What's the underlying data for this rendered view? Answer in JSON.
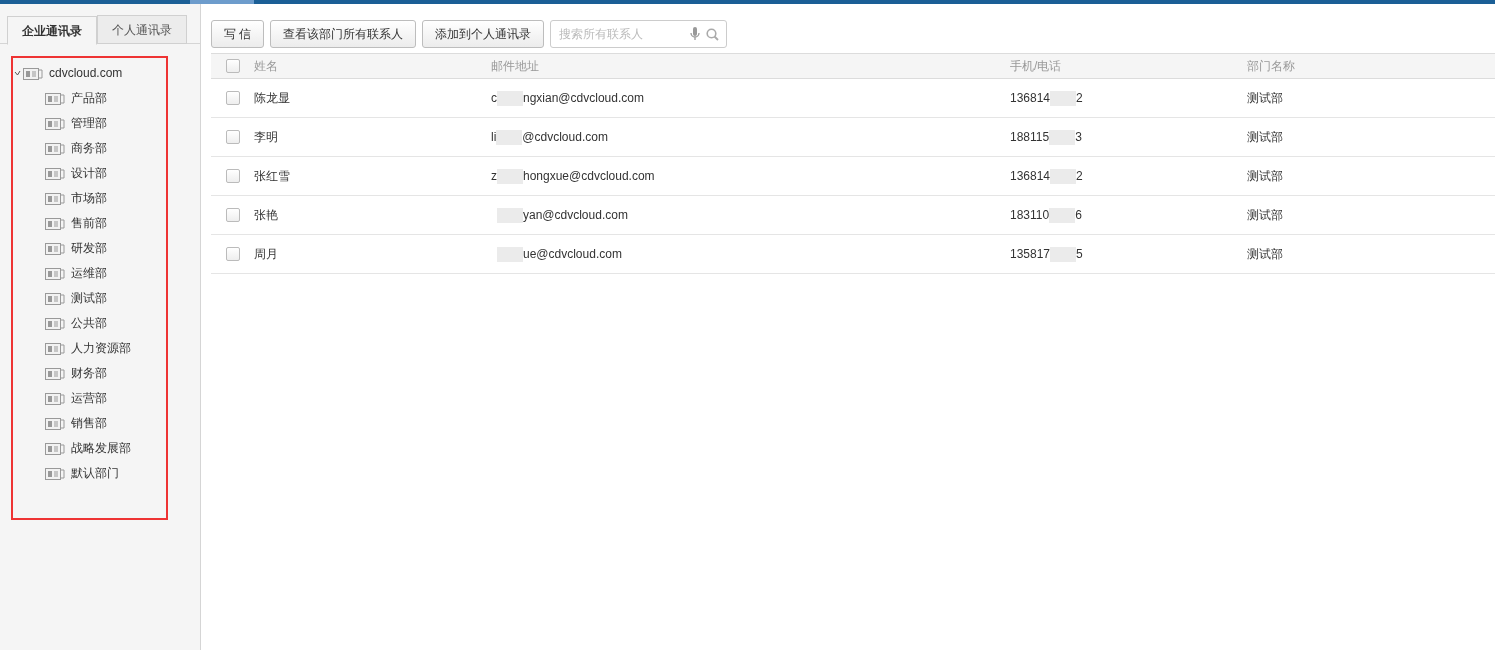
{
  "sidebar": {
    "tabs": [
      {
        "label": "企业通讯录",
        "selected": true
      },
      {
        "label": "个人通讯录",
        "selected": false
      }
    ],
    "tree": [
      {
        "label": "cdvcloud.com",
        "expanded": true,
        "children": [
          {
            "label": "产品部"
          },
          {
            "label": "管理部"
          },
          {
            "label": "商务部"
          },
          {
            "label": "设计部"
          },
          {
            "label": "市场部"
          },
          {
            "label": "售前部"
          },
          {
            "label": "研发部"
          },
          {
            "label": "运维部"
          },
          {
            "label": "测试部"
          },
          {
            "label": "公共部"
          },
          {
            "label": "人力资源部"
          },
          {
            "label": "财务部"
          },
          {
            "label": "运营部"
          },
          {
            "label": "销售部"
          },
          {
            "label": "战略发展部"
          },
          {
            "label": "默认部门"
          }
        ]
      }
    ]
  },
  "toolbar": {
    "buttons": [
      "写 信",
      "查看该部门所有联系人",
      "添加到个人通讯录"
    ],
    "search": {
      "placeholder": "搜索所有联系人"
    }
  },
  "table": {
    "columns": [
      "姓名",
      "邮件地址",
      "手机/电话",
      "部门名称"
    ],
    "header_checked": false,
    "rows": [
      {
        "checked": false,
        "name": "陈龙显",
        "email_start": "c",
        "email_end": "ngxian@cdvcloud.com",
        "phone_start": "136814",
        "phone_end": "2",
        "department": "测试部"
      },
      {
        "checked": false,
        "name": "李明",
        "email_start": "li",
        "email_end": "@cdvcloud.com",
        "phone_start": "188115",
        "phone_end": "3",
        "department": "测试部"
      },
      {
        "checked": false,
        "name": "张红雪",
        "email_start": "z",
        "email_end": "hongxue@cdvcloud.com",
        "phone_start": "136814",
        "phone_end": "2",
        "department": "测试部"
      },
      {
        "checked": false,
        "name": "张艳",
        "email_end": "yan@cdvcloud.com",
        "phone_start": "183110",
        "phone_end": "6",
        "department": "测试部"
      },
      {
        "checked": false,
        "name": "周月",
        "email_end": "ue@cdvcloud.com",
        "phone_start": "135817",
        "phone_end": "5",
        "department": "测试部"
      }
    ]
  }
}
